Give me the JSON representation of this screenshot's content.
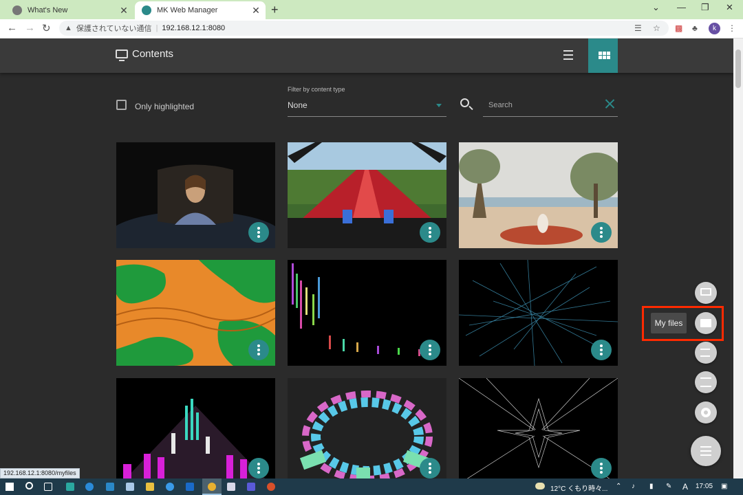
{
  "browser": {
    "tabs": [
      {
        "title": "What's New",
        "active": false
      },
      {
        "title": "MK Web Manager",
        "active": true
      }
    ],
    "security_label": "保護されていない通信",
    "url": "192.168.12.1:8080",
    "profile_initial": "k",
    "new_tab_glyph": "+",
    "close_glyph": "✕",
    "window_controls": [
      "⌄",
      "—",
      "❐",
      "✕"
    ]
  },
  "app": {
    "title": "Contents",
    "only_highlighted_label": "Only highlighted",
    "filter_label": "Filter by content type",
    "filter_value": "None",
    "search_placeholder": "Search",
    "tooltip": "My files",
    "status_url": "192.168.12.1:8080/myfiles",
    "accent_color": "#2b8a8a",
    "highlight_color": "#ff2a00"
  },
  "cards": [
    {
      "thumb": "portrait-dome"
    },
    {
      "thumb": "rollercoaster"
    },
    {
      "thumb": "beach-meditation"
    },
    {
      "thumb": "orange-green-waves"
    },
    {
      "thumb": "stock-candles"
    },
    {
      "thumb": "blue-line-web"
    },
    {
      "thumb": "neon-bars-landscape"
    },
    {
      "thumb": "ring-of-blocks"
    },
    {
      "thumb": "white-star-lines"
    }
  ],
  "fab_menu": [
    "monitor-icon",
    "folder-icon",
    "playlist-icon",
    "sliders-icon",
    "gear-icon"
  ],
  "taskbar": {
    "weather": "12°C くもり時々...",
    "ime": "A",
    "time": "17:05"
  }
}
